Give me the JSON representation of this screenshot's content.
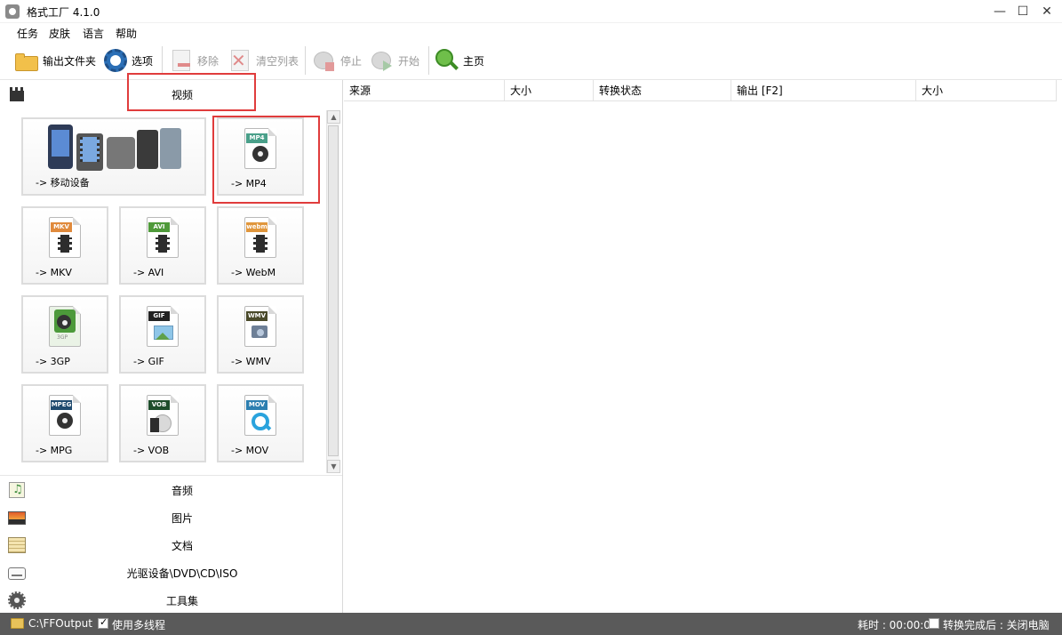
{
  "window": {
    "title": "格式工厂 4.1.0",
    "minimize": "—",
    "maximize": "☐",
    "close": "✕"
  },
  "menu": [
    "任务",
    "皮肤",
    "语言",
    "帮助"
  ],
  "toolbar": {
    "output_folder": "输出文件夹",
    "options": "选项",
    "remove": "移除",
    "clear_list": "清空列表",
    "stop": "停止",
    "start": "开始",
    "home": "主页"
  },
  "left": {
    "video_header": "视频",
    "tiles": [
      {
        "label": "-> 移动设备"
      },
      {
        "label": "-> MP4",
        "tag": "MP4"
      },
      {
        "label": "-> MKV",
        "tag": "MKV"
      },
      {
        "label": "-> AVI",
        "tag": "AVI"
      },
      {
        "label": "-> WebM",
        "tag": "webm"
      },
      {
        "label": "-> 3GP",
        "tag": "3GP"
      },
      {
        "label": "-> GIF",
        "tag": "GIF"
      },
      {
        "label": "-> WMV",
        "tag": "WMV"
      },
      {
        "label": "-> MPG",
        "tag": "MPEG"
      },
      {
        "label": "-> VOB",
        "tag": "VOB"
      },
      {
        "label": "-> MOV",
        "tag": "MOV"
      }
    ],
    "categories": [
      "音频",
      "图片",
      "文档",
      "光驱设备\\DVD\\CD\\ISO",
      "工具集"
    ],
    "scroll_up": "▲",
    "scroll_down": "▼"
  },
  "table": {
    "columns": [
      "来源",
      "大小",
      "转换状态",
      "输出 [F2]",
      "大小"
    ]
  },
  "status": {
    "output_path": "C:\\FFOutput",
    "multithread": "使用多线程",
    "elapsed": "耗时 : 00:00:00",
    "after_done": "转换完成后 : 关闭电脑"
  }
}
